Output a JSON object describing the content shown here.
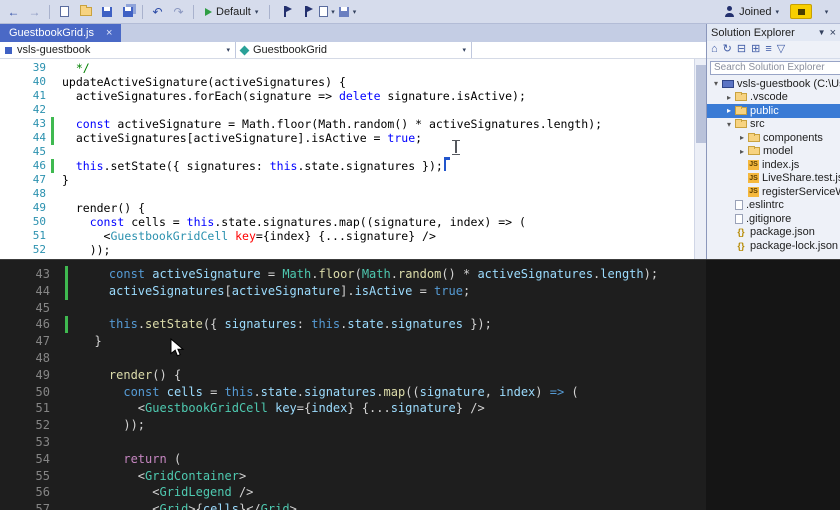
{
  "theme": {
    "tab_active": "#4a69c6",
    "selection": "#3a7bd5",
    "change_bar": "#3fb950",
    "caret": "#2255cc",
    "notification": "#f8cf00",
    "dark_bg": "#1e1e1e"
  },
  "toolbar": {
    "default_label": "Default",
    "joined_label": "Joined"
  },
  "tabs": [
    {
      "label": "GuestbookGrid.js",
      "active": true
    }
  ],
  "breadcrumb": {
    "file_scope": "vsls-guestbook",
    "symbol_scope": "GuestbookGrid"
  },
  "editor_light": {
    "lines": [
      {
        "n": 39,
        "t": [
          [
            "  */",
            "com"
          ]
        ]
      },
      {
        "n": 40,
        "t": [
          [
            "updateActiveSignature(activeSignatures) {",
            "d"
          ]
        ]
      },
      {
        "n": 41,
        "t": [
          [
            "  activeSignatures.forEach(signature => ",
            "d"
          ],
          [
            "delete",
            "kw"
          ],
          [
            " signature.isActive);",
            "d"
          ]
        ]
      },
      {
        "n": 42,
        "t": []
      },
      {
        "n": 43,
        "m": true,
        "t": [
          [
            "  ",
            "d"
          ],
          [
            "const",
            "kw"
          ],
          [
            " activeSignature = Math.floor(Math.random() * activeSignatures.length);",
            "d"
          ]
        ]
      },
      {
        "n": 44,
        "m": true,
        "t": [
          [
            "  activeSignatures[activeSignature].isActive = ",
            "d"
          ],
          [
            "true",
            "kw"
          ],
          [
            ";",
            "d"
          ]
        ]
      },
      {
        "n": 45,
        "t": []
      },
      {
        "n": 46,
        "m": true,
        "caret": true,
        "t": [
          [
            "  ",
            "d"
          ],
          [
            "this",
            "kw"
          ],
          [
            ".setState({ signatures: ",
            "d"
          ],
          [
            "this",
            "kw"
          ],
          [
            ".state.signatures });",
            "d"
          ]
        ]
      },
      {
        "n": 47,
        "t": [
          [
            "}",
            "d"
          ]
        ]
      },
      {
        "n": 48,
        "t": []
      },
      {
        "n": 49,
        "t": [
          [
            "  render() {",
            "d"
          ]
        ]
      },
      {
        "n": 50,
        "t": [
          [
            "    ",
            "d"
          ],
          [
            "const",
            "kw"
          ],
          [
            " cells = ",
            "d"
          ],
          [
            "this",
            "kw"
          ],
          [
            ".state.signatures.map((signature, index) => (",
            "d"
          ]
        ]
      },
      {
        "n": 51,
        "t": [
          [
            "      <",
            "d"
          ],
          [
            "GuestbookGridCell",
            "tag"
          ],
          [
            " ",
            "d"
          ],
          [
            "key",
            "attr"
          ],
          [
            "={index} {...signature} />",
            "d"
          ]
        ]
      },
      {
        "n": 52,
        "t": [
          [
            "    ));",
            "d"
          ]
        ]
      }
    ]
  },
  "editor_dark": {
    "lines": [
      {
        "n": 43,
        "m": true,
        "t": [
          [
            "    ",
            "d"
          ],
          [
            "const",
            "kw"
          ],
          [
            " ",
            "d"
          ],
          [
            "activeSignature",
            "var"
          ],
          [
            " = ",
            "d"
          ],
          [
            "Math",
            "cls"
          ],
          [
            ".",
            "d"
          ],
          [
            "floor",
            "fn"
          ],
          [
            "(",
            "d"
          ],
          [
            "Math",
            "cls"
          ],
          [
            ".",
            "d"
          ],
          [
            "random",
            "fn"
          ],
          [
            "() * ",
            "d"
          ],
          [
            "activeSignatures",
            "var"
          ],
          [
            ".",
            "d"
          ],
          [
            "length",
            "var"
          ],
          [
            ");",
            "d"
          ]
        ]
      },
      {
        "n": 44,
        "m": true,
        "t": [
          [
            "    ",
            "d"
          ],
          [
            "activeSignatures",
            "var"
          ],
          [
            "[",
            "d"
          ],
          [
            "activeSignature",
            "var"
          ],
          [
            "].",
            "d"
          ],
          [
            "isActive",
            "var"
          ],
          [
            " = ",
            "d"
          ],
          [
            "true",
            "kw"
          ],
          [
            ";",
            "d"
          ]
        ]
      },
      {
        "n": 45,
        "t": []
      },
      {
        "n": 46,
        "m": true,
        "t": [
          [
            "    ",
            "d"
          ],
          [
            "this",
            "kw"
          ],
          [
            ".",
            "d"
          ],
          [
            "setState",
            "fn"
          ],
          [
            "({ ",
            "d"
          ],
          [
            "signatures",
            "var"
          ],
          [
            ": ",
            "d"
          ],
          [
            "this",
            "kw"
          ],
          [
            ".",
            "d"
          ],
          [
            "state",
            "var"
          ],
          [
            ".",
            "d"
          ],
          [
            "signatures",
            "var"
          ],
          [
            " });",
            "d"
          ]
        ]
      },
      {
        "n": 47,
        "t": [
          [
            "  }",
            "d"
          ]
        ]
      },
      {
        "n": 48,
        "t": []
      },
      {
        "n": 49,
        "t": [
          [
            "    ",
            "d"
          ],
          [
            "render",
            "fn"
          ],
          [
            "() {",
            "d"
          ]
        ]
      },
      {
        "n": 50,
        "t": [
          [
            "      ",
            "d"
          ],
          [
            "const",
            "kw"
          ],
          [
            " ",
            "d"
          ],
          [
            "cells",
            "var"
          ],
          [
            " = ",
            "d"
          ],
          [
            "this",
            "kw"
          ],
          [
            ".",
            "d"
          ],
          [
            "state",
            "var"
          ],
          [
            ".",
            "d"
          ],
          [
            "signatures",
            "var"
          ],
          [
            ".",
            "d"
          ],
          [
            "map",
            "fn"
          ],
          [
            "((",
            "d"
          ],
          [
            "signature",
            "var"
          ],
          [
            ", ",
            "d"
          ],
          [
            "index",
            "var"
          ],
          [
            ") ",
            "d"
          ],
          [
            "=>",
            "kw"
          ],
          [
            " (",
            "d"
          ]
        ]
      },
      {
        "n": 51,
        "t": [
          [
            "        <",
            "d"
          ],
          [
            "GuestbookGridCell",
            "tag"
          ],
          [
            " ",
            "d"
          ],
          [
            "key",
            "attr"
          ],
          [
            "=",
            "d"
          ],
          [
            "{",
            "d"
          ],
          [
            "index",
            "var"
          ],
          [
            "} {...",
            "d"
          ],
          [
            "signature",
            "var"
          ],
          [
            "} />",
            "d"
          ]
        ]
      },
      {
        "n": 52,
        "t": [
          [
            "      ));",
            "d"
          ]
        ]
      },
      {
        "n": 53,
        "t": []
      },
      {
        "n": 54,
        "t": [
          [
            "      ",
            "d"
          ],
          [
            "return",
            "ctrl"
          ],
          [
            " (",
            "d"
          ]
        ]
      },
      {
        "n": 55,
        "t": [
          [
            "        <",
            "d"
          ],
          [
            "GridContainer",
            "tag"
          ],
          [
            ">",
            "d"
          ]
        ]
      },
      {
        "n": 56,
        "t": [
          [
            "          <",
            "d"
          ],
          [
            "GridLegend",
            "tag"
          ],
          [
            " />",
            "d"
          ]
        ]
      },
      {
        "n": 57,
        "t": [
          [
            "          <",
            "d"
          ],
          [
            "Grid",
            "tag"
          ],
          [
            ">{",
            "d"
          ],
          [
            "cells",
            "var"
          ],
          [
            "}</",
            "d"
          ],
          [
            "Grid",
            "tag"
          ],
          [
            ">",
            "d"
          ]
        ]
      }
    ]
  },
  "solution_explorer": {
    "title": "Solution Explorer",
    "search_placeholder": "Search Solution Explorer",
    "tree": [
      {
        "label": "vsls-guestbook (C:\\Use",
        "depth": 0,
        "icon": "project",
        "arrow": "expanded"
      },
      {
        "label": ".vscode",
        "depth": 1,
        "icon": "folder",
        "arrow": "collapsed"
      },
      {
        "label": "public",
        "depth": 1,
        "icon": "folder",
        "arrow": "collapsed",
        "selected": true
      },
      {
        "label": "src",
        "depth": 1,
        "icon": "folder",
        "arrow": "expanded"
      },
      {
        "label": "components",
        "depth": 2,
        "icon": "folder",
        "arrow": "collapsed"
      },
      {
        "label": "model",
        "depth": 2,
        "icon": "folder",
        "arrow": "collapsed"
      },
      {
        "label": "index.js",
        "depth": 2,
        "icon": "js"
      },
      {
        "label": "LiveShare.test.js",
        "depth": 2,
        "icon": "js"
      },
      {
        "label": "registerServiceWor...",
        "depth": 2,
        "icon": "js"
      },
      {
        "label": ".eslintrc",
        "depth": 1,
        "icon": "file"
      },
      {
        "label": ".gitignore",
        "depth": 1,
        "icon": "file"
      },
      {
        "label": "package.json",
        "depth": 1,
        "icon": "json"
      },
      {
        "label": "package-lock.json",
        "depth": 1,
        "icon": "json"
      }
    ]
  }
}
